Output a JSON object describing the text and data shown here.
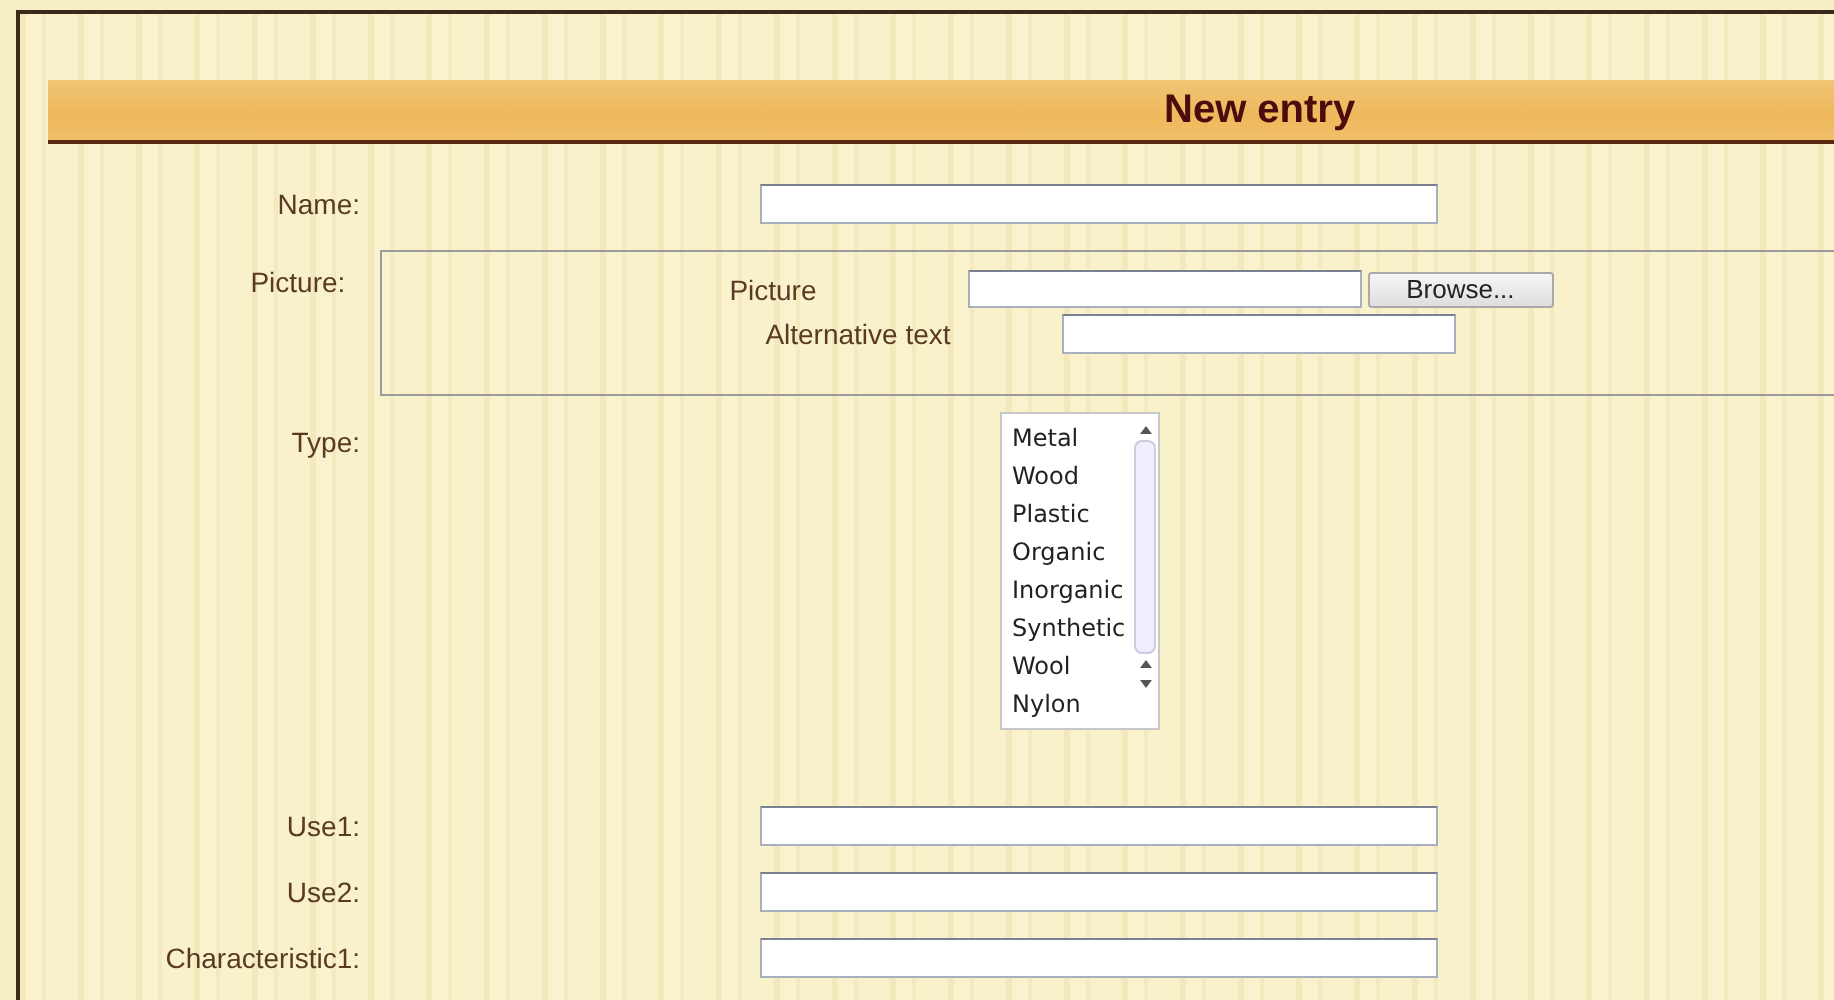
{
  "heading": "New entry",
  "fields": [
    {
      "label": "Name:",
      "kind": "text"
    },
    {
      "label": "Picture:",
      "kind": "picture",
      "picture_label": "Picture",
      "browse_button": "Browse...",
      "alt_label": "Alternative text"
    },
    {
      "label": "Type:",
      "kind": "list",
      "options": [
        "Metal",
        "Wood",
        "Plastic",
        "Organic",
        "Inorganic",
        "Synthetic",
        "Wool",
        "Nylon"
      ]
    },
    {
      "label": "Use1:",
      "kind": "text"
    },
    {
      "label": "Use2:",
      "kind": "text"
    },
    {
      "label": "Characteristic1:",
      "kind": "text"
    }
  ]
}
